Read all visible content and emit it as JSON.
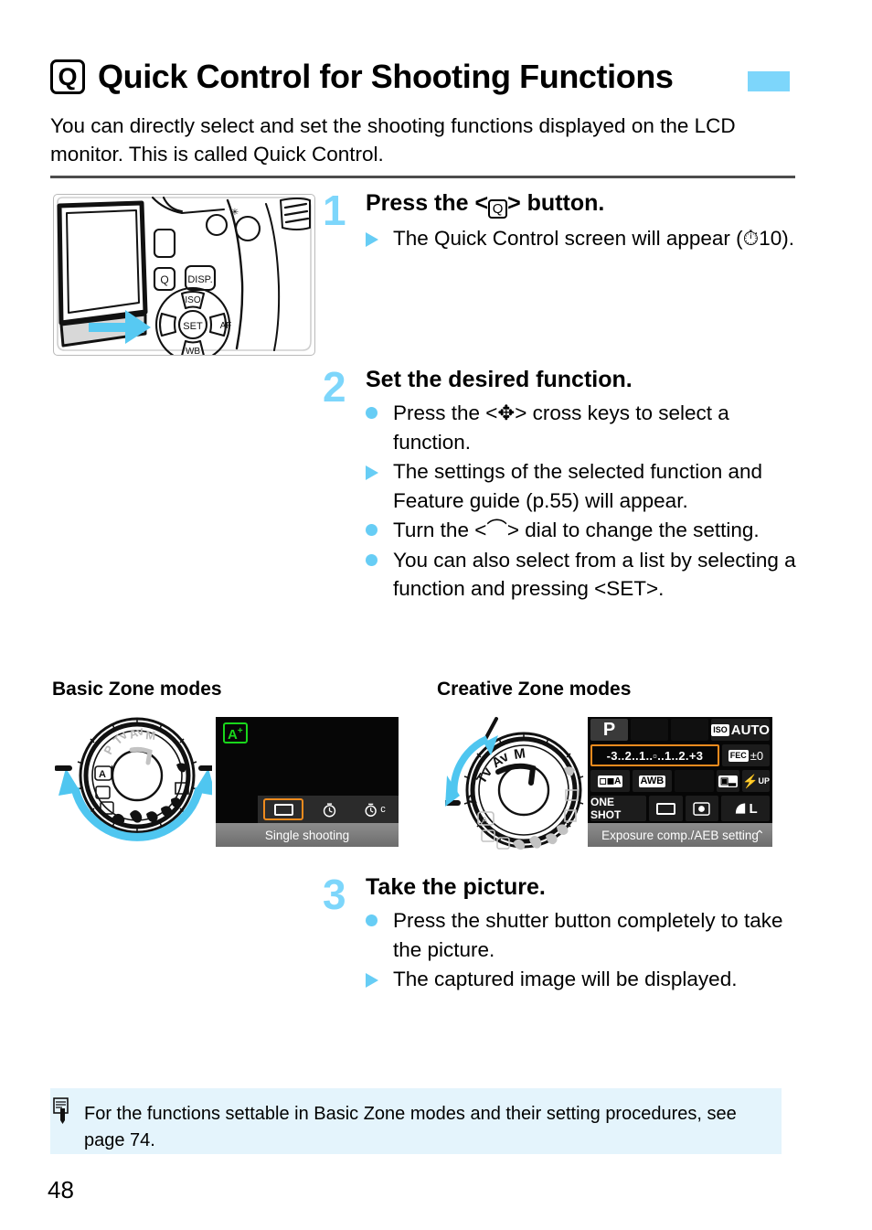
{
  "heading": {
    "icon": "q-button-icon",
    "icon_label": "Q",
    "title": "Quick Control for Shooting Functions",
    "tab_color": "#7dd6fb"
  },
  "intro": "You can directly select and set the shooting functions displayed on the LCD monitor. This is called Quick Control.",
  "steps": [
    {
      "number": "1",
      "title_before": "Press the <",
      "title_icon": "Q",
      "title_after": "> button.",
      "bullets": [
        {
          "mark": "triangle",
          "text": "The Quick Control screen will appear (⏱10)."
        }
      ]
    },
    {
      "number": "2",
      "title": "Set the desired function.",
      "bullets": [
        {
          "mark": "dot",
          "text": "Press the <✥> cross keys to select a function."
        },
        {
          "mark": "triangle",
          "text": "The settings of the selected function and Feature guide (p.55) will appear."
        },
        {
          "mark": "dot",
          "text": "Turn the <⌒> dial to change the setting."
        },
        {
          "mark": "dot",
          "text": "You can also select from a list by selecting a function and pressing <SET>."
        }
      ]
    },
    {
      "number": "3",
      "title": "Take the picture.",
      "bullets": [
        {
          "mark": "dot",
          "text": "Press the shutter button completely to take the picture."
        },
        {
          "mark": "triangle",
          "text": "The captured image will be displayed."
        }
      ]
    }
  ],
  "figures": {
    "camera_illustration": "camera-back-q-button",
    "basic_zone": {
      "caption": "Basic Zone modes",
      "dial_label": "mode-dial-basic-zone",
      "lcd": {
        "mode_icon": "A",
        "mode_icon_sup": "+",
        "drive_items": [
          {
            "name": "single-shooting",
            "glyph": "▭",
            "selected": true
          },
          {
            "name": "self-timer-10sec",
            "glyph": "⏲",
            "selected": false
          },
          {
            "name": "self-timer-continuous",
            "glyph": "⏲c",
            "selected": false
          }
        ],
        "feature_guide": "Single shooting"
      }
    },
    "creative_zone": {
      "caption": "Creative Zone modes",
      "dial_label": "mode-dial-creative-zone",
      "lcd": {
        "rows": [
          [
            {
              "name": "shooting-mode",
              "text": "P",
              "type": "mode"
            },
            {
              "name": "shutter-speed",
              "text": "",
              "type": "empty"
            },
            {
              "name": "aperture",
              "text": "",
              "type": "empty"
            },
            {
              "name": "iso-speed",
              "text": "AUTO",
              "prefix": "ISO",
              "type": "iso"
            }
          ],
          [
            {
              "name": "exposure-compensation-aeb",
              "text": "-3..2..1..▫..1..2.+3",
              "type": "exposure",
              "selected": true
            },
            {
              "name": "flash-exposure-compensation",
              "text": "±0",
              "prefix": "FEC",
              "type": "fec"
            }
          ],
          [
            {
              "name": "picture-style",
              "text": "A",
              "type": "style"
            },
            {
              "name": "white-balance",
              "text": "AWB",
              "type": "wb"
            },
            {
              "name": "wb-shift",
              "text": "",
              "type": "empty"
            },
            {
              "name": "auto-lighting-optimizer",
              "text": "",
              "type": "alo"
            },
            {
              "name": "flash-pop-up",
              "text": "UP",
              "type": "flash"
            }
          ],
          [
            {
              "name": "af-mode",
              "text": "ONE SHOT",
              "type": "af"
            },
            {
              "name": "af-point-selection",
              "text": "",
              "type": "afpoint"
            },
            {
              "name": "metering-mode",
              "text": "",
              "type": "metering"
            },
            {
              "name": "image-quality",
              "text": "L",
              "type": "quality"
            }
          ]
        ],
        "feature_guide": "Exposure comp./AEB setting"
      }
    }
  },
  "note": {
    "icon": "note-pencil-icon",
    "text": "For the functions settable in Basic Zone modes and their setting procedures, see page 74."
  },
  "page_number": "48",
  "colors": {
    "accent_blue": "#7dd6fb",
    "note_bg": "#e4f4fc",
    "selection_orange": "#ef8b1e",
    "mode_green": "#19d71b"
  }
}
